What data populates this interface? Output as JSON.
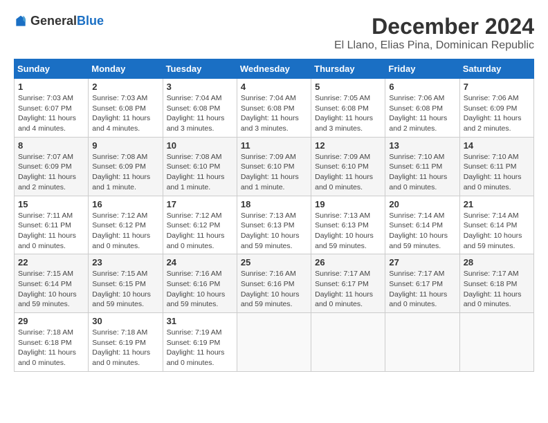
{
  "logo": {
    "text_general": "General",
    "text_blue": "Blue"
  },
  "title": {
    "month": "December 2024",
    "location": "El Llano, Elias Pina, Dominican Republic"
  },
  "headers": [
    "Sunday",
    "Monday",
    "Tuesday",
    "Wednesday",
    "Thursday",
    "Friday",
    "Saturday"
  ],
  "weeks": [
    [
      {
        "day": "1",
        "sunrise": "7:03 AM",
        "sunset": "6:07 PM",
        "daylight": "11 hours and 4 minutes."
      },
      {
        "day": "2",
        "sunrise": "7:03 AM",
        "sunset": "6:08 PM",
        "daylight": "11 hours and 4 minutes."
      },
      {
        "day": "3",
        "sunrise": "7:04 AM",
        "sunset": "6:08 PM",
        "daylight": "11 hours and 3 minutes."
      },
      {
        "day": "4",
        "sunrise": "7:04 AM",
        "sunset": "6:08 PM",
        "daylight": "11 hours and 3 minutes."
      },
      {
        "day": "5",
        "sunrise": "7:05 AM",
        "sunset": "6:08 PM",
        "daylight": "11 hours and 3 minutes."
      },
      {
        "day": "6",
        "sunrise": "7:06 AM",
        "sunset": "6:08 PM",
        "daylight": "11 hours and 2 minutes."
      },
      {
        "day": "7",
        "sunrise": "7:06 AM",
        "sunset": "6:09 PM",
        "daylight": "11 hours and 2 minutes."
      }
    ],
    [
      {
        "day": "8",
        "sunrise": "7:07 AM",
        "sunset": "6:09 PM",
        "daylight": "11 hours and 2 minutes."
      },
      {
        "day": "9",
        "sunrise": "7:08 AM",
        "sunset": "6:09 PM",
        "daylight": "11 hours and 1 minute."
      },
      {
        "day": "10",
        "sunrise": "7:08 AM",
        "sunset": "6:10 PM",
        "daylight": "11 hours and 1 minute."
      },
      {
        "day": "11",
        "sunrise": "7:09 AM",
        "sunset": "6:10 PM",
        "daylight": "11 hours and 1 minute."
      },
      {
        "day": "12",
        "sunrise": "7:09 AM",
        "sunset": "6:10 PM",
        "daylight": "11 hours and 0 minutes."
      },
      {
        "day": "13",
        "sunrise": "7:10 AM",
        "sunset": "6:11 PM",
        "daylight": "11 hours and 0 minutes."
      },
      {
        "day": "14",
        "sunrise": "7:10 AM",
        "sunset": "6:11 PM",
        "daylight": "11 hours and 0 minutes."
      }
    ],
    [
      {
        "day": "15",
        "sunrise": "7:11 AM",
        "sunset": "6:11 PM",
        "daylight": "11 hours and 0 minutes."
      },
      {
        "day": "16",
        "sunrise": "7:12 AM",
        "sunset": "6:12 PM",
        "daylight": "11 hours and 0 minutes."
      },
      {
        "day": "17",
        "sunrise": "7:12 AM",
        "sunset": "6:12 PM",
        "daylight": "11 hours and 0 minutes."
      },
      {
        "day": "18",
        "sunrise": "7:13 AM",
        "sunset": "6:13 PM",
        "daylight": "10 hours and 59 minutes."
      },
      {
        "day": "19",
        "sunrise": "7:13 AM",
        "sunset": "6:13 PM",
        "daylight": "10 hours and 59 minutes."
      },
      {
        "day": "20",
        "sunrise": "7:14 AM",
        "sunset": "6:14 PM",
        "daylight": "10 hours and 59 minutes."
      },
      {
        "day": "21",
        "sunrise": "7:14 AM",
        "sunset": "6:14 PM",
        "daylight": "10 hours and 59 minutes."
      }
    ],
    [
      {
        "day": "22",
        "sunrise": "7:15 AM",
        "sunset": "6:14 PM",
        "daylight": "10 hours and 59 minutes."
      },
      {
        "day": "23",
        "sunrise": "7:15 AM",
        "sunset": "6:15 PM",
        "daylight": "10 hours and 59 minutes."
      },
      {
        "day": "24",
        "sunrise": "7:16 AM",
        "sunset": "6:16 PM",
        "daylight": "10 hours and 59 minutes."
      },
      {
        "day": "25",
        "sunrise": "7:16 AM",
        "sunset": "6:16 PM",
        "daylight": "10 hours and 59 minutes."
      },
      {
        "day": "26",
        "sunrise": "7:17 AM",
        "sunset": "6:17 PM",
        "daylight": "11 hours and 0 minutes."
      },
      {
        "day": "27",
        "sunrise": "7:17 AM",
        "sunset": "6:17 PM",
        "daylight": "11 hours and 0 minutes."
      },
      {
        "day": "28",
        "sunrise": "7:17 AM",
        "sunset": "6:18 PM",
        "daylight": "11 hours and 0 minutes."
      }
    ],
    [
      {
        "day": "29",
        "sunrise": "7:18 AM",
        "sunset": "6:18 PM",
        "daylight": "11 hours and 0 minutes."
      },
      {
        "day": "30",
        "sunrise": "7:18 AM",
        "sunset": "6:19 PM",
        "daylight": "11 hours and 0 minutes."
      },
      {
        "day": "31",
        "sunrise": "7:19 AM",
        "sunset": "6:19 PM",
        "daylight": "11 hours and 0 minutes."
      },
      null,
      null,
      null,
      null
    ]
  ],
  "labels": {
    "sunrise": "Sunrise:",
    "sunset": "Sunset:",
    "daylight": "Daylight:"
  }
}
